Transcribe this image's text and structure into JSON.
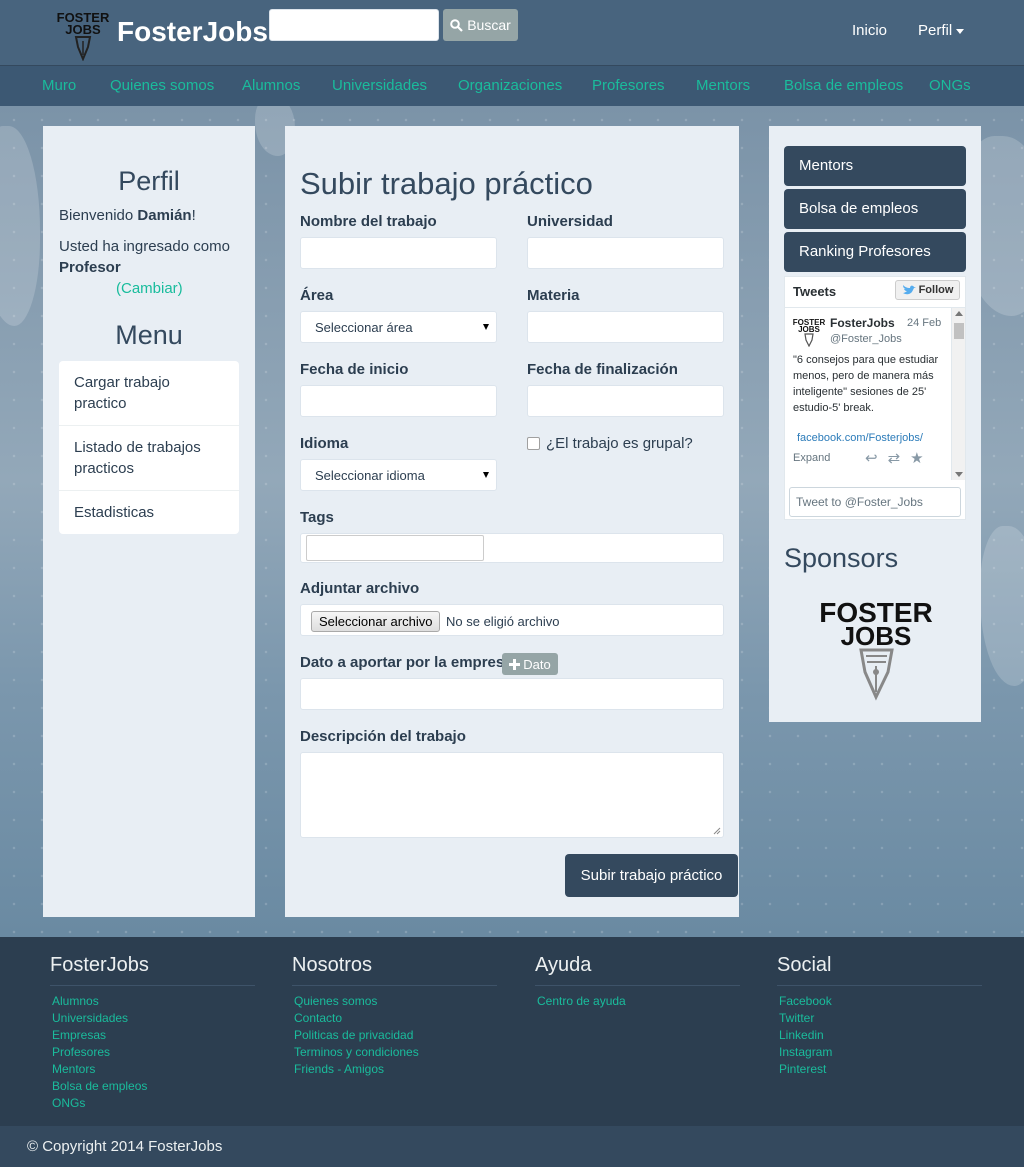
{
  "header": {
    "brand": "FosterJobs",
    "search_placeholder": "",
    "search_label": "Buscar",
    "nav_right": [
      "Inicio",
      "Perfil"
    ]
  },
  "nav": [
    "Muro",
    "Quienes somos",
    "Alumnos",
    "Universidades",
    "Organizaciones",
    "Profesores",
    "Mentors",
    "Bolsa de empleos",
    "ONGs"
  ],
  "left": {
    "perfil_title": "Perfil",
    "welcome_prefix": "Bienvenido ",
    "welcome_name": "Damián",
    "welcome_suffix": "!",
    "logged_as": "Usted ha ingresado como",
    "role": "Profesor",
    "change": "(Cambiar)",
    "menu_title": "Menu",
    "menu": [
      "Cargar trabajo practico",
      "Listado de trabajos practicos",
      "Estadisticas"
    ]
  },
  "form": {
    "title": "Subir trabajo práctico",
    "nombre_label": "Nombre del trabajo",
    "universidad_label": "Universidad",
    "area_label": "Área",
    "area_value": "Seleccionar área",
    "materia_label": "Materia",
    "inicio_label": "Fecha de inicio",
    "fin_label": "Fecha de finalización",
    "idioma_label": "Idioma",
    "idioma_value": "Seleccionar idioma",
    "grupal_label": "¿El trabajo es grupal?",
    "tags_label": "Tags",
    "adjuntar_label": "Adjuntar archivo",
    "file_button": "Seleccionar archivo",
    "file_status": "No se eligió archivo",
    "dato_label": "Dato a aportar por la empresa",
    "dato_button": "Dato",
    "descripcion_label": "Descripción del trabajo",
    "submit": "Subir trabajo práctico"
  },
  "right": {
    "buttons": [
      "Mentors",
      "Bolsa de empleos",
      "Ranking Profesores"
    ],
    "tweets": {
      "title": "Tweets",
      "follow": "Follow",
      "name": "FosterJobs",
      "date": "24 Feb",
      "handle": "@Foster_Jobs",
      "text": "\"6 consejos para que estudiar menos, pero de manera más inteligente\" sesiones de 25' estudio-5' break.",
      "link": "facebook.com/Fosterjobs/",
      "expand": "Expand",
      "input_placeholder": "Tweet to @Foster_Jobs"
    },
    "sponsors_title": "Sponsors"
  },
  "footer": {
    "cols": [
      {
        "title": "FosterJobs",
        "links": [
          "Alumnos",
          "Universidades",
          "Empresas",
          "Profesores",
          "Mentors",
          "Bolsa de empleos",
          "ONGs"
        ]
      },
      {
        "title": "Nosotros",
        "links": [
          "Quienes somos",
          "Contacto",
          "Politicas de privacidad",
          "Terminos y condiciones",
          "Friends - Amigos"
        ]
      },
      {
        "title": "Ayuda",
        "links": [
          "Centro de ayuda"
        ]
      },
      {
        "title": "Social",
        "links": [
          "Facebook",
          "Twitter",
          "Linkedin",
          "Instagram",
          "Pinterest"
        ]
      }
    ],
    "copyright": "© Copyright 2014 FosterJobs"
  },
  "icons": {
    "search": "search-icon",
    "plus": "plus-icon",
    "twitter": "twitter-bird-icon",
    "reply": "reply-icon",
    "retweet": "retweet-icon",
    "favorite": "star-icon"
  },
  "colors": {
    "primary": "#34495e",
    "accent": "#1abc9c",
    "header": "#48647e",
    "navbar": "#3c5873",
    "panel": "#e8eef4"
  }
}
